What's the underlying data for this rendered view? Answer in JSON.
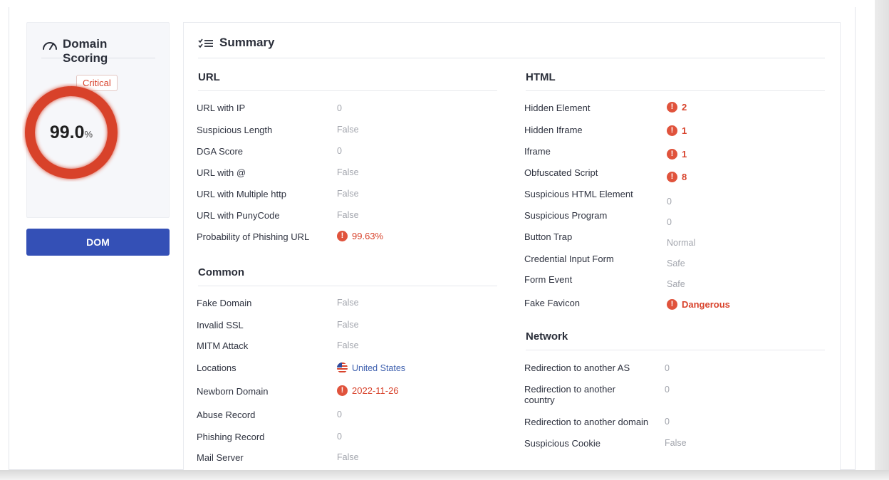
{
  "scoring": {
    "title": "Domain Scoring",
    "icon": "gauge-icon",
    "badge": "Critical",
    "value": "99.0",
    "unit": "%",
    "percent": 99.0,
    "color": "#d8432c"
  },
  "dom_button": {
    "label": "DOM",
    "color": "#3450b6"
  },
  "summary": {
    "title": "Summary",
    "icon": "checklist-icon",
    "url": {
      "title": "URL",
      "rows": [
        {
          "label": "URL with IP",
          "value": "0"
        },
        {
          "label": "Suspicious Length",
          "value": "False"
        },
        {
          "label": "DGA Score",
          "value": "0"
        },
        {
          "label": "URL with @",
          "value": "False"
        },
        {
          "label": "URL with Multiple http",
          "value": "False"
        },
        {
          "label": "URL with PunyCode",
          "value": "False"
        },
        {
          "label": "Probability of Phishing URL",
          "value": "99.63%",
          "status": "danger"
        }
      ]
    },
    "common": {
      "title": "Common",
      "rows": [
        {
          "label": "Fake Domain",
          "value": "False"
        },
        {
          "label": "Invalid SSL",
          "value": "False"
        },
        {
          "label": "MITM Attack",
          "value": "False"
        },
        {
          "label": "Locations",
          "value": "United States",
          "icon": "us-flag-icon"
        },
        {
          "label": "Newborn Domain",
          "value": "2022-11-26",
          "status": "danger"
        },
        {
          "label": "Abuse Record",
          "value": "0"
        },
        {
          "label": "Phishing Record",
          "value": "0"
        },
        {
          "label": "Mail Server",
          "value": "False"
        }
      ]
    },
    "html": {
      "title": "HTML",
      "rows": [
        {
          "label": "Hidden Element",
          "value": "2",
          "status": "danger"
        },
        {
          "label": "Hidden Iframe",
          "value": "1",
          "status": "danger"
        },
        {
          "label": "Iframe",
          "value": "1",
          "status": "danger"
        },
        {
          "label": "Obfuscated Script",
          "value": "8",
          "status": "danger"
        },
        {
          "label": "Suspicious HTML Element",
          "value": "0"
        },
        {
          "label": "Suspicious Program",
          "value": "0"
        },
        {
          "label": "Button Trap",
          "value": "Normal"
        },
        {
          "label": "Credential Input Form",
          "value": "Safe"
        },
        {
          "label": "Form Event",
          "value": "Safe"
        },
        {
          "label": "Fake Favicon",
          "value": "Dangerous",
          "status": "danger"
        }
      ]
    },
    "network": {
      "title": "Network",
      "rows": [
        {
          "label": "Redirection to another AS",
          "value": "0"
        },
        {
          "label_line1": "Redirection to another",
          "label_line2": "country",
          "value": "0"
        },
        {
          "label": "Redirection to another domain",
          "value": "0"
        },
        {
          "label": "Suspicious Cookie",
          "value": "False"
        }
      ]
    }
  }
}
